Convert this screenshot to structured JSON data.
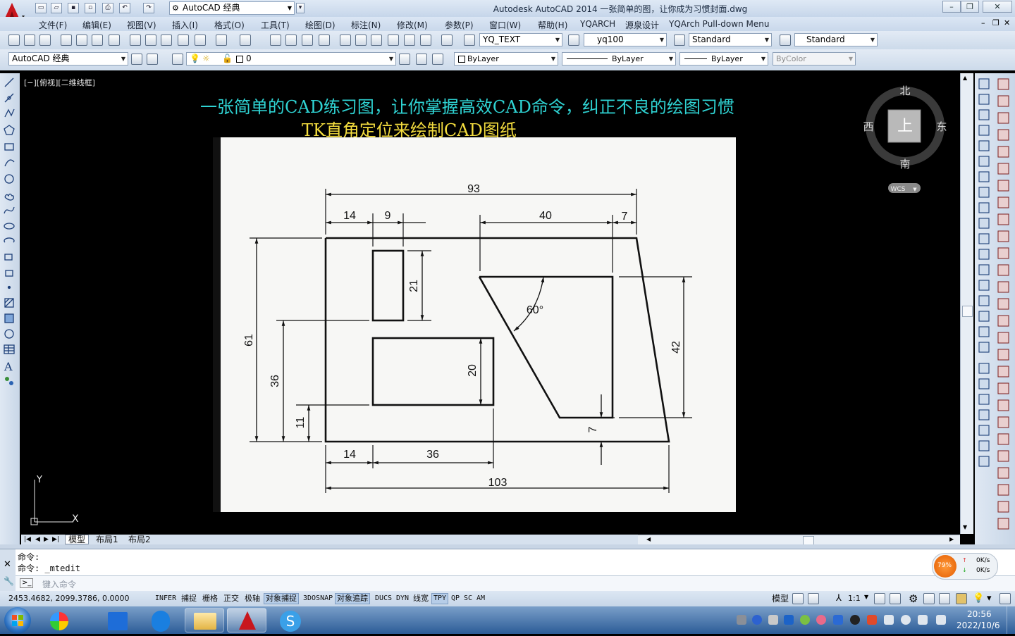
{
  "app": {
    "title": "Autodesk AutoCAD 2014    一张简单的图，让你成为习惯封面.dwg",
    "workspace": "AutoCAD 经典"
  },
  "menu": [
    "文件(F)",
    "编辑(E)",
    "视图(V)",
    "插入(I)",
    "格式(O)",
    "工具(T)",
    "绘图(D)",
    "标注(N)",
    "修改(M)",
    "参数(P)",
    "窗口(W)",
    "帮助(H)",
    "YQARCH",
    "源泉设计",
    "YQArch Pull-down Menu"
  ],
  "toolbar1": {
    "text_style": "YQ_TEXT",
    "dim_style": "yq100",
    "table_style": "Standard",
    "multileader_style": "Standard"
  },
  "toolbar2": {
    "workspace": "AutoCAD 经典",
    "layer": "0",
    "color": "ByLayer",
    "linetype": "ByLayer",
    "lineweight": "ByLayer",
    "plotstyle": "ByColor"
  },
  "viewport": {
    "label": "[−][俯视][二维线框]"
  },
  "viewcube": {
    "north": "北",
    "south": "南",
    "east": "东",
    "west": "西",
    "face": "上",
    "wcs": "WCS"
  },
  "drawing": {
    "heading1": "一张简单的CAD练习图，让你掌握高效CAD命令，纠正不良的绘图习惯",
    "heading2": "TK直角定位来绘制CAD图纸",
    "heading1_color": "#2fd3d3",
    "heading2_color": "#f3dc3e",
    "dims": [
      "93",
      "14",
      "9",
      "40",
      "7",
      "61",
      "21",
      "60°",
      "36",
      "20",
      "42",
      "11",
      "7",
      "14",
      "36",
      "103"
    ]
  },
  "ucs": {
    "x": "X",
    "y": "Y"
  },
  "tabs": [
    "模型",
    "布局1",
    "布局2"
  ],
  "command": {
    "line1": "命令:",
    "line2": "命令: _mtedit",
    "placeholder": "键入命令"
  },
  "net": {
    "percent": "79%",
    "up": "0K/s",
    "down": "0K/s"
  },
  "status": {
    "coords": "2453.4682, 2099.3786, 0.0000",
    "toggles": [
      "INFER",
      "捕捉",
      "栅格",
      "正交",
      "极轴",
      "对象捕捉",
      "3DOSNAP",
      "对象追踪",
      "DUCS",
      "DYN",
      "线宽",
      "TPY",
      "QP",
      "SC",
      "AM"
    ],
    "active": [
      "对象捕捉",
      "对象追踪",
      "TPY"
    ],
    "model": "模型",
    "scale": "1:1"
  },
  "clock": {
    "time": "20:56",
    "date": "2022/10/6"
  }
}
